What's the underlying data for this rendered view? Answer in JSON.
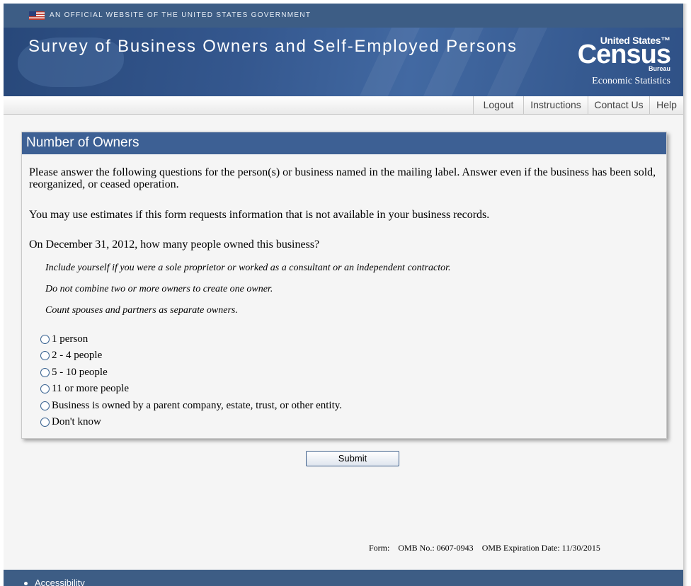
{
  "gov_banner": {
    "text": "AN OFFICIAL WEBSITE OF THE UNITED STATES GOVERNMENT"
  },
  "header": {
    "title": "Survey of Business Owners and Self-Employed Persons",
    "logo": {
      "line1": "United States™",
      "line2": "Census",
      "line3": "Bureau",
      "tagline": "Economic Statistics"
    }
  },
  "nav": {
    "items": [
      "Logout",
      "Instructions",
      "Contact Us",
      "Help"
    ]
  },
  "section": {
    "title": "Number of Owners",
    "intro": "Please answer the following questions for the person(s) or business named in the mailing label. Answer even if the business has been sold, reorganized, or ceased operation.",
    "estimates": "You may use estimates if this form requests information that is not available in your business records.",
    "question": "On December 31, 2012, how many people owned this business?",
    "notes": [
      "Include yourself if you were a sole proprietor or worked as a consultant or an independent contractor.",
      "Do not combine two or more owners to create one owner.",
      "Count spouses and partners as separate owners."
    ],
    "options": [
      "1 person",
      "2 - 4 people",
      "5 - 10 people",
      "11 or more people",
      "Business is owned by a parent company, estate, trust, or other entity.",
      "Don't know"
    ]
  },
  "submit_label": "Submit",
  "footer_form": {
    "form_label": "Form:",
    "omb_no": "OMB No.: 0607-0943",
    "omb_exp": "OMB Expiration Date: 11/30/2015"
  },
  "footer": {
    "link": "Accessibility"
  },
  "colors": {
    "header_blue": "#3d5d85",
    "panel_head": "#3d6094",
    "page_bg": "#f5f5f5"
  }
}
